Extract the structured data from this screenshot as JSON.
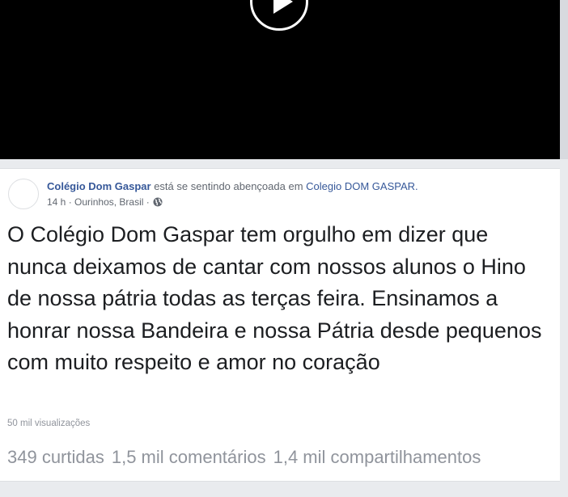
{
  "video": {
    "play_icon": "play-icon",
    "background": "#000000"
  },
  "post": {
    "author": "Colégio Dom Gaspar",
    "feeling_prefix": "está",
    "feeling": "se sentindo abençoada em",
    "location": "Colegio DOM GASPAR.",
    "time": "14 h",
    "separator": "·",
    "place": "Ourinhos, Brasil",
    "privacy_icon": "globe-icon",
    "text": "O Colégio Dom Gaspar tem orgulho em dizer que nunca deixamos de cantar com nossos alunos o Hino de nossa pátria todas as terças feira. Ensinamos a honrar nossa Bandeira e nossa Pátria desde pequenos com muito respeito e amor no coração",
    "views": "50 mil visualizações",
    "likes": "349 curtidas",
    "comments": "1,5 mil comentários",
    "shares": "1,4 mil compartilhamentos"
  },
  "colors": {
    "link": "#365899",
    "meta": "#616770",
    "muted": "#90949c",
    "background": "#e9ebee"
  }
}
